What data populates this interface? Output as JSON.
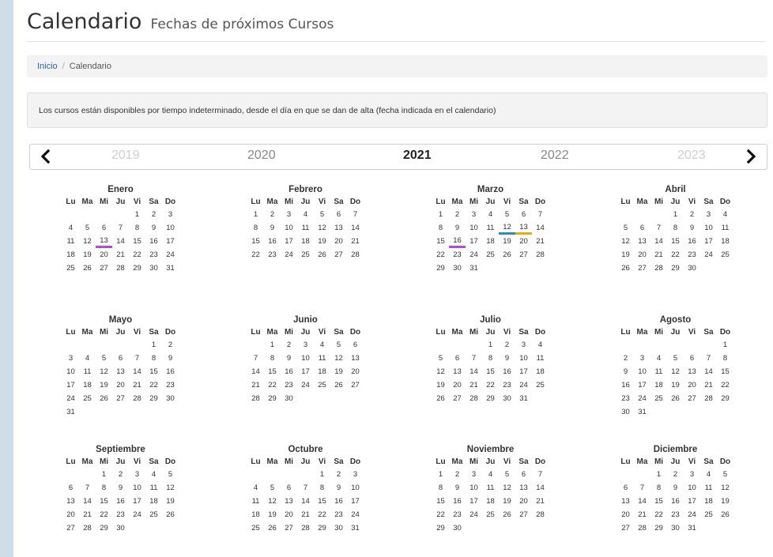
{
  "header": {
    "title": "Calendario",
    "subtitle": "Fechas de próximos Cursos"
  },
  "breadcrumb": {
    "home": "Inicio",
    "separator": "/",
    "current": "Calendario"
  },
  "notice": "Los cursos están disponibles por tiempo indeterminado, desde el día en que se dan de alta (fecha indicada en el calendario)",
  "years": [
    "2019",
    "2020",
    "2021",
    "2022",
    "2023"
  ],
  "active_year": "2021",
  "weekday_headers": [
    "Lu",
    "Ma",
    "Mi",
    "Ju",
    "Vi",
    "Sa",
    "Do"
  ],
  "marker_colors": {
    "purple": "#b050c8",
    "blue": "#2e8fb5",
    "yellow": "#d9b21e"
  },
  "months": [
    {
      "name": "Enero",
      "start": 4,
      "days": 31,
      "marks": {
        "13": "purple"
      }
    },
    {
      "name": "Febrero",
      "start": 0,
      "days": 28,
      "marks": {}
    },
    {
      "name": "Marzo",
      "start": 0,
      "days": 31,
      "marks": {
        "12": "blue",
        "13": "yellow",
        "16": "purple"
      }
    },
    {
      "name": "Abril",
      "start": 3,
      "days": 30,
      "marks": {}
    },
    {
      "name": "Mayo",
      "start": 5,
      "days": 31,
      "marks": {}
    },
    {
      "name": "Junio",
      "start": 1,
      "days": 30,
      "marks": {}
    },
    {
      "name": "Julio",
      "start": 3,
      "days": 31,
      "marks": {}
    },
    {
      "name": "Agosto",
      "start": 6,
      "days": 31,
      "marks": {}
    },
    {
      "name": "Septiembre",
      "start": 2,
      "days": 30,
      "marks": {}
    },
    {
      "name": "Octubre",
      "start": 4,
      "days": 31,
      "marks": {}
    },
    {
      "name": "Noviembre",
      "start": 0,
      "days": 30,
      "marks": {}
    },
    {
      "name": "Diciembre",
      "start": 2,
      "days": 31,
      "marks": {}
    }
  ]
}
